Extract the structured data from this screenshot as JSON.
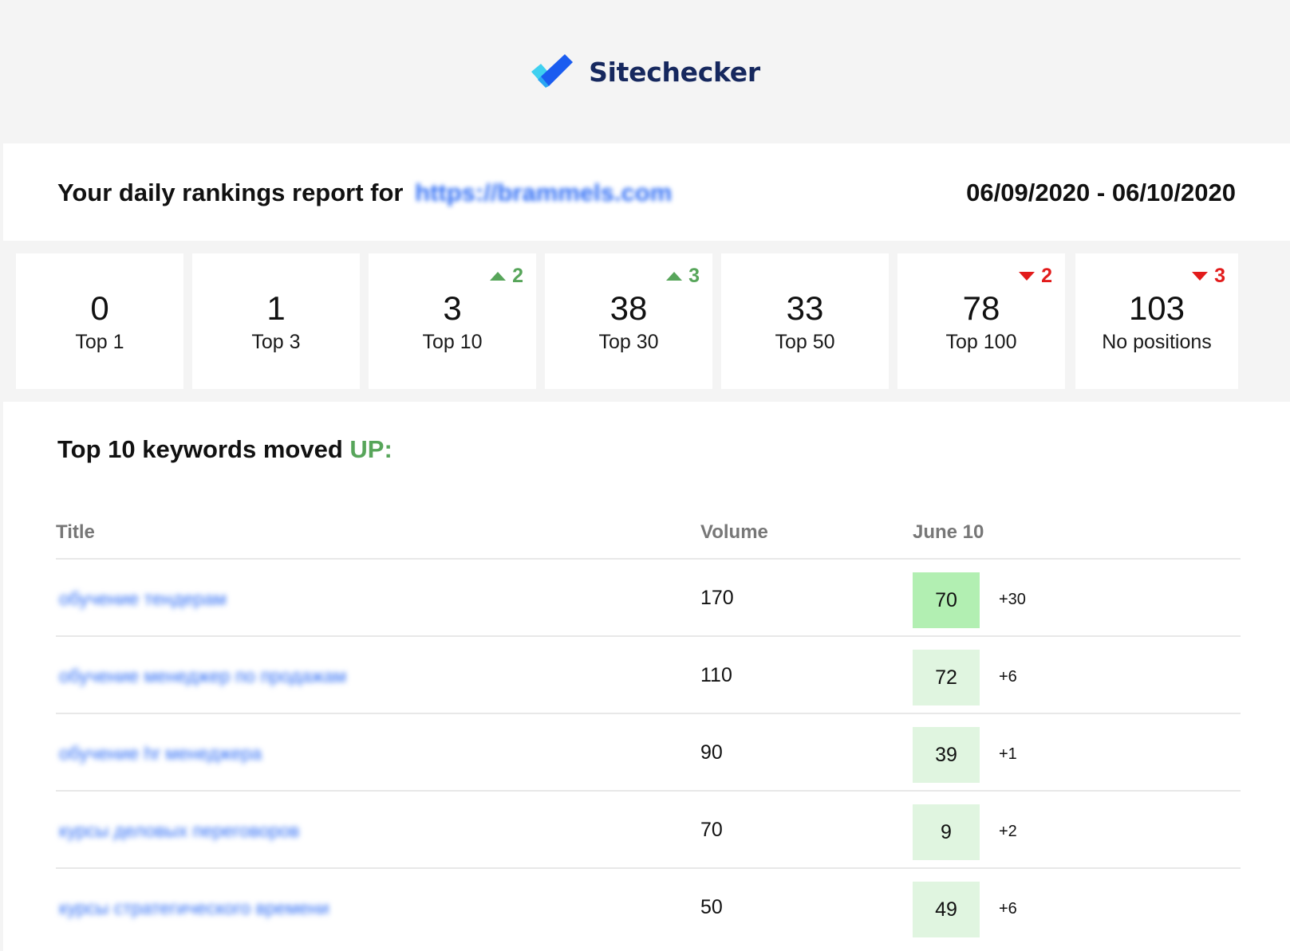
{
  "brand": {
    "name": "Sitechecker",
    "colors": {
      "navy": "#16285e",
      "light_blue": "#3fd0f0",
      "blue": "#1a5cf0"
    }
  },
  "report": {
    "title_prefix": "Your daily rankings report for",
    "url": "https://brammels.com",
    "date_range": "06/09/2020 - 06/10/2020"
  },
  "stats": [
    {
      "value": "0",
      "label": "Top 1",
      "change": null,
      "direction": null
    },
    {
      "value": "1",
      "label": "Top 3",
      "change": null,
      "direction": null
    },
    {
      "value": "3",
      "label": "Top 10",
      "change": "2",
      "direction": "up"
    },
    {
      "value": "38",
      "label": "Top 30",
      "change": "3",
      "direction": "up"
    },
    {
      "value": "33",
      "label": "Top 50",
      "change": null,
      "direction": null
    },
    {
      "value": "78",
      "label": "Top 100",
      "change": "2",
      "direction": "down"
    },
    {
      "value": "103",
      "label": "No positions",
      "change": "3",
      "direction": "down"
    }
  ],
  "moved_up": {
    "title_prefix": "Top 10 keywords moved",
    "title_highlight": "UP:",
    "columns": {
      "title": "Title",
      "volume": "Volume",
      "date": "June 10"
    },
    "rows": [
      {
        "title": "обучение тендерам",
        "volume": "170",
        "position": "70",
        "delta": "+30",
        "highlight_color": "#b2efb2"
      },
      {
        "title": "обучение менеджер по продажам",
        "volume": "110",
        "position": "72",
        "delta": "+6",
        "highlight_color": "#e0f5e0"
      },
      {
        "title": "обучение hr менеджера",
        "volume": "90",
        "position": "39",
        "delta": "+1",
        "highlight_color": "#e0f5e0"
      },
      {
        "title": "курсы деловых переговоров",
        "volume": "70",
        "position": "9",
        "delta": "+2",
        "highlight_color": "#e0f5e0"
      },
      {
        "title": "курсы стратегического времени",
        "volume": "50",
        "position": "49",
        "delta": "+6",
        "highlight_color": "#e0f5e0"
      }
    ]
  }
}
